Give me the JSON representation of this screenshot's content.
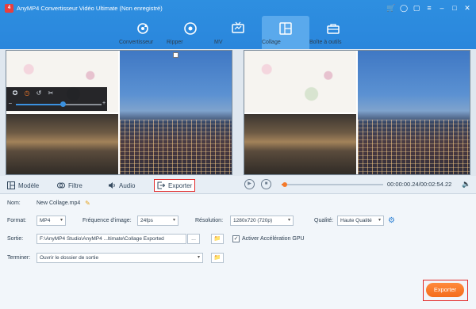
{
  "app": {
    "logo_text": "4",
    "title": "AnyMP4 Convertisseur Vidéo Ultimate (Non enregistré)"
  },
  "titlebar_icons": [
    "cart-icon",
    "user-icon",
    "chat-icon",
    "menu-icon",
    "minimize-icon",
    "maximize-icon",
    "close-icon"
  ],
  "nav": {
    "items": [
      {
        "label": "Convertisseur",
        "icon": "refresh-icon"
      },
      {
        "label": "Ripper",
        "icon": "disc-icon"
      },
      {
        "label": "MV",
        "icon": "tv-icon"
      },
      {
        "label": "Collage",
        "icon": "collage-icon"
      },
      {
        "label": "Boîte à outils",
        "icon": "toolbox-icon"
      }
    ],
    "active": "Collage"
  },
  "editor": {
    "volume_level": 0.55
  },
  "tabs": [
    {
      "label": "Modèle",
      "icon": "template-icon"
    },
    {
      "label": "Filtre",
      "icon": "filter-icon"
    },
    {
      "label": "Audio",
      "icon": "audio-icon"
    },
    {
      "label": "Exporter",
      "icon": "export-icon"
    }
  ],
  "playback": {
    "current": "00:00:00.24",
    "total": "00:02:54.22",
    "timecode": "00:00:00.24/00:02:54.22",
    "progress": 0.0014
  },
  "settings": {
    "name_label": "Nom:",
    "name_value": "New Collage.mp4",
    "format_label": "Format:",
    "format_value": "MP4",
    "framerate_label": "Fréquence d'image:",
    "framerate_value": "24fps",
    "resolution_label": "Résolution:",
    "resolution_value": "1280x720 (720p)",
    "quality_label": "Qualité:",
    "quality_value": "Haute Qualité",
    "output_label": "Sortie:",
    "output_path": "F:\\AnyMP4 Studio\\AnyMP4 ...ltimate\\Collage Exported",
    "more_label": "...",
    "gpu_label": "Activer Accélération GPU",
    "gpu_checked": true,
    "finish_label": "Terminer:",
    "finish_value": "Ouvrir le dossier de sortie"
  },
  "export_button": "Exporter",
  "colors": {
    "header_blue": "#2e8fe0",
    "accent_orange": "#f47a2b",
    "highlight_red": "#e22a2a"
  }
}
